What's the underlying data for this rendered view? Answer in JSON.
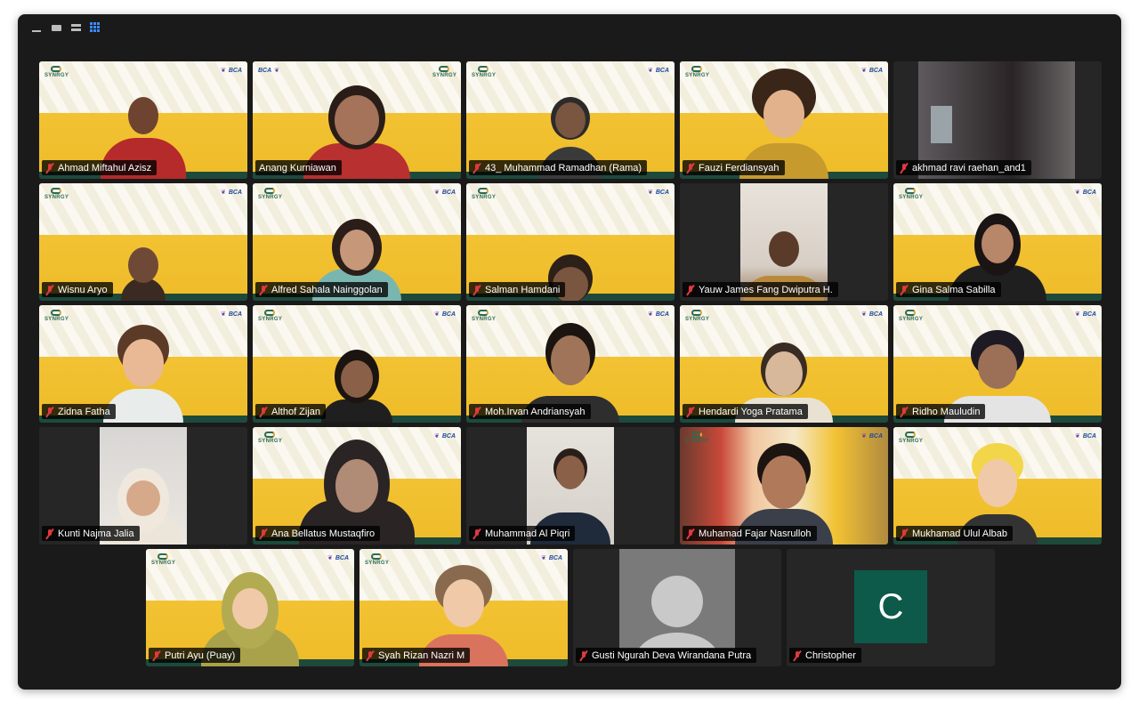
{
  "window": {
    "view_controls": [
      {
        "icon": "minimize-icon"
      },
      {
        "icon": "speaker-view-icon"
      },
      {
        "icon": "strip-view-icon"
      },
      {
        "icon": "gallery-view-icon",
        "active": true
      }
    ]
  },
  "colors": {
    "active_speaker_border": "#2fd15a",
    "muted_mic": "#e0393e",
    "tile_bg": "#262626",
    "gallery_icon": "#3b8bff",
    "avatar_c": "#0d5a4a"
  },
  "logos": {
    "synrgy": "SYNRGY",
    "bca": "BCA"
  },
  "participants": [
    {
      "name": "Ahmad Miftahul Azisz",
      "muted": true
    },
    {
      "name": "Anang Kurniawan",
      "muted": false,
      "active_speaker": true
    },
    {
      "name": "43_ Muhammad Ramadhan (Rama)",
      "muted": true
    },
    {
      "name": "Fauzi Ferdiansyah",
      "muted": true
    },
    {
      "name": "akhmad ravi raehan_and1",
      "muted": true
    },
    {
      "name": "Wisnu Aryo",
      "muted": true
    },
    {
      "name": "Alfred Sahala Nainggolan",
      "muted": true
    },
    {
      "name": "Salman Hamdani",
      "muted": true
    },
    {
      "name": "Yauw James Fang Dwiputra H.",
      "muted": true
    },
    {
      "name": "Gina Salma Sabilla",
      "muted": true
    },
    {
      "name": "Zidna Fatha",
      "muted": true
    },
    {
      "name": "Althof Zijan",
      "muted": true
    },
    {
      "name": "Moh.Irvan Andriansyah",
      "muted": true
    },
    {
      "name": "Hendardi Yoga Pratama",
      "muted": true
    },
    {
      "name": "Ridho Mauludin",
      "muted": true
    },
    {
      "name": "Kunti Najma Jalia",
      "muted": true
    },
    {
      "name": "Ana Bellatus Mustaqfiro",
      "muted": true
    },
    {
      "name": "Muhammad Al Piqri",
      "muted": true
    },
    {
      "name": "Muhamad Fajar Nasrulloh",
      "muted": true
    },
    {
      "name": "Mukhamad Ulul Albab",
      "muted": true
    },
    {
      "name": "Putri Ayu (Puay)",
      "muted": true
    },
    {
      "name": "Syah Rizan Nazri M",
      "muted": true
    },
    {
      "name": "Gusti Ngurah Deva Wirandana Putra",
      "muted": true,
      "video_off": true
    },
    {
      "name": "Christopher",
      "muted": true,
      "video_off": true,
      "initial": "C"
    }
  ]
}
